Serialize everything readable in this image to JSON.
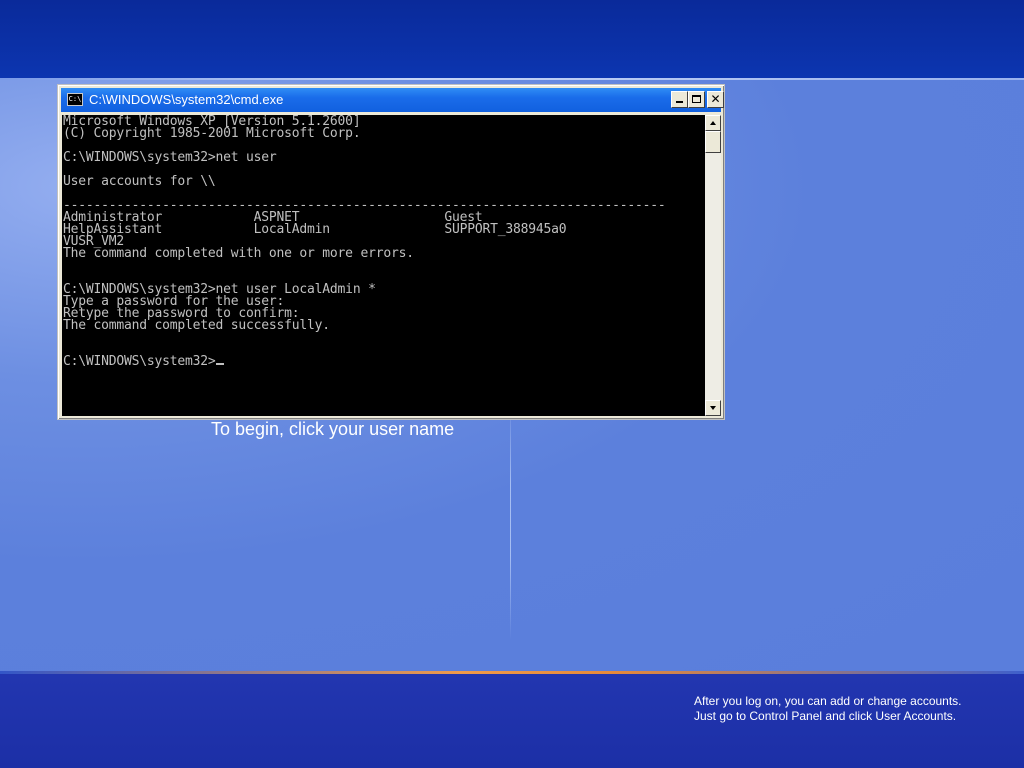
{
  "colors": {
    "background": "#5a7edc",
    "top_band": "#0c35b0",
    "bottom_band": "#1c2fa6",
    "title_bar": "#1a6cea",
    "console_bg": "#000000",
    "console_fg": "#c0c0c0",
    "accent_line": "#f09a4a"
  },
  "welcome": {
    "begin_text": "To begin, click your user name",
    "help_line1": "After you log on, you can add or change accounts.",
    "help_line2": "Just go to Control Panel and click User Accounts."
  },
  "cmd_window": {
    "title": "C:\\WINDOWS\\system32\\cmd.exe",
    "icon_name": "console-icon",
    "icon_glyph": "C:\\",
    "minimize_label": "minimize",
    "maximize_label": "maximize",
    "close_glyph": "✕",
    "console_lines": [
      "Microsoft Windows XP [Version 5.1.2600]",
      "(C) Copyright 1985-2001 Microsoft Corp.",
      "",
      "C:\\WINDOWS\\system32>net user",
      "",
      "User accounts for \\\\",
      "",
      "-------------------------------------------------------------------------------",
      "Administrator            ASPNET                   Guest",
      "HelpAssistant            LocalAdmin               SUPPORT_388945a0",
      "VUSR_VM2",
      "The command completed with one or more errors.",
      "",
      "",
      "C:\\WINDOWS\\system32>net user LocalAdmin *",
      "Type a password for the user:",
      "Retype the password to confirm:",
      "The command completed successfully.",
      "",
      "",
      "C:\\WINDOWS\\system32>"
    ]
  }
}
